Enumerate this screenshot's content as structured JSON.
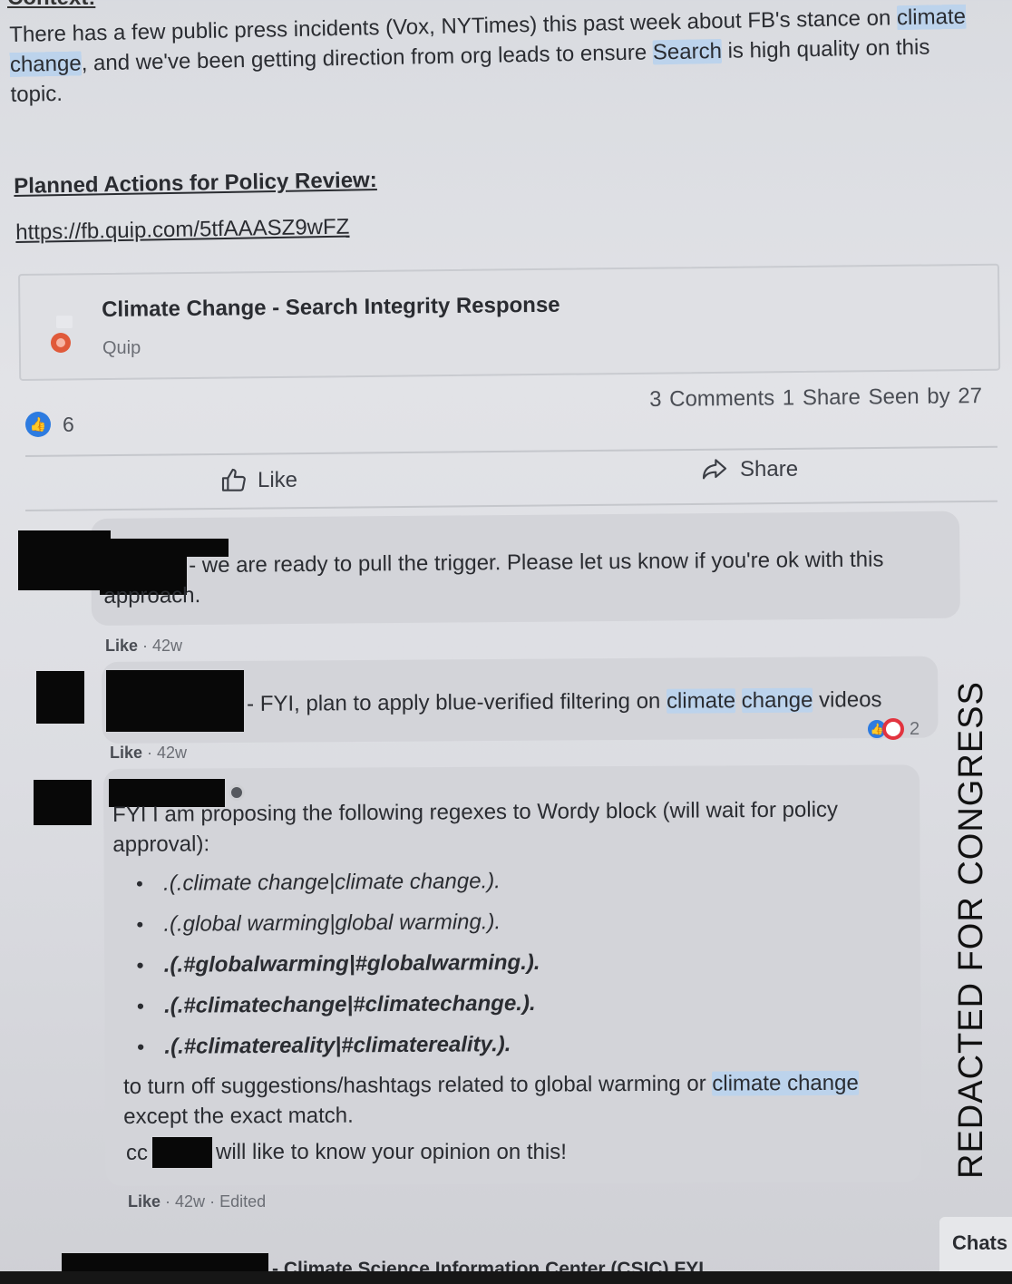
{
  "post": {
    "section_heading": "Context:",
    "body_parts": {
      "p1": "There has a few public press incidents (Vox, NYTimes) this past week about FB's stance on",
      "hl1": "climate change",
      "p2": ", and we've been getting direction from org leads to ensure",
      "hl2": "Search",
      "p3": "is high quality on this topic."
    },
    "planned_actions_heading": "Planned Actions for Policy Review:",
    "link_text": "https://fb.quip.com/5tfAAASZ9wFZ"
  },
  "link_card": {
    "title": "Climate Change - Search Integrity Response",
    "source": "Quip",
    "icon": "quip-icon"
  },
  "reactions": {
    "like_icon": "thumbs-up-icon",
    "count": "6",
    "comments": "3 Comments",
    "shares": "1 Share",
    "seen": "Seen by 27"
  },
  "actions": {
    "like_label": "Like",
    "share_label": "Share"
  },
  "comments": [
    {
      "text": "- we are ready to pull the trigger. Please let us know if you're ok with this approach.",
      "like": "Like",
      "time": "42w"
    },
    {
      "text_before": "- FYI, plan to apply blue-verified filtering on",
      "hl1": "climate",
      "hl2": "change",
      "text_after": "videos",
      "reaction_count": "2",
      "like": "Like",
      "time": "42w"
    },
    {
      "intro": "FYI I am proposing the following regexes to Wordy block (will wait for policy approval):",
      "regexes": [
        ".(.climate change|climate change.).",
        ".(.global warming|global warming.).",
        ".(.#globalwarming|#globalwarming.).",
        ".(.#climatechange|#climatechange.).",
        ".(.#climatereality|#climatereality.)."
      ],
      "outro_before": "to turn off suggestions/hashtags related to global warming or",
      "outro_hl": "climate change",
      "outro_after": "except the exact match.",
      "cc_label": "cc",
      "cc_after": "will like to know your opinion on this!",
      "like": "Like",
      "time": "42w",
      "edited": "Edited"
    }
  ],
  "stamp": "REDACTED FOR CONGRESS",
  "chats_label": "Chats",
  "bottom_partial": "- Climate Science Information Center (CSIC) FYI"
}
